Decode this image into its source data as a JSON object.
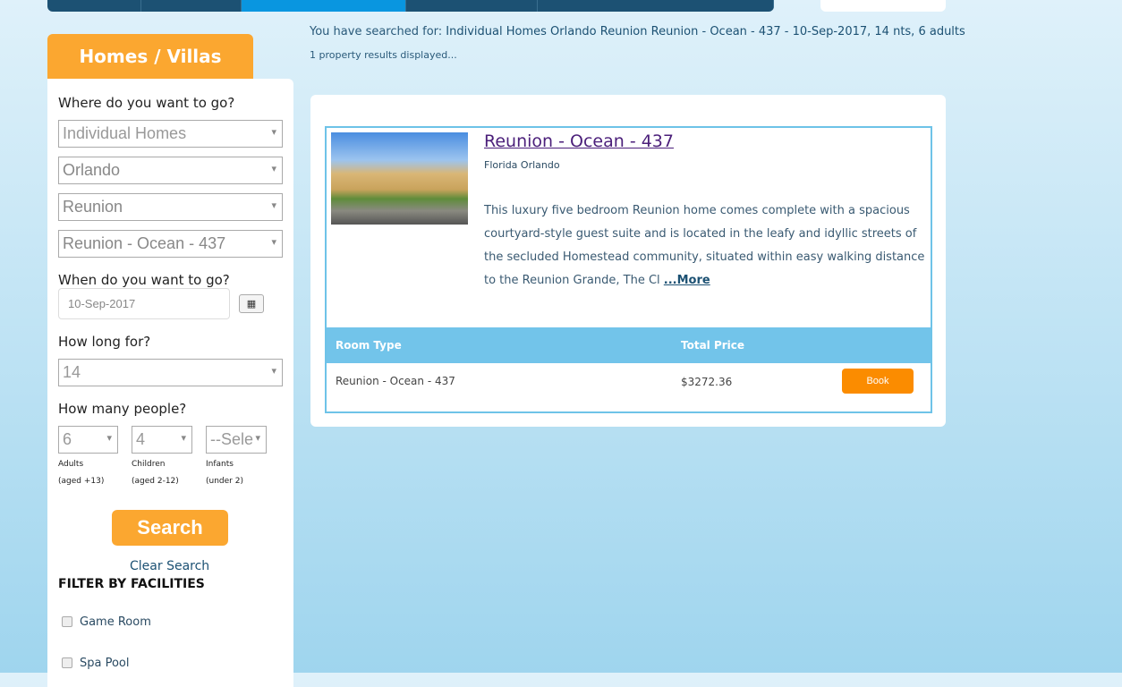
{
  "sidebar": {
    "tab": "Homes / Villas",
    "where_label": "Where do you want to go?",
    "selects": [
      "Individual Homes",
      "Orlando",
      "Reunion",
      "Reunion - Ocean - 437"
    ],
    "when_label": "When do you want to go?",
    "date": "10-Sep-2017",
    "howlong_label": "How long for?",
    "nights": "14",
    "people_label": "How many people?",
    "adults": "6",
    "children": "4",
    "infants": "--Sele",
    "adults_label": "Adults",
    "adults_sub": "(aged +13)",
    "children_label": "Children",
    "children_sub": "(aged 2-12)",
    "infants_label": "Infants",
    "infants_sub": "(under 2)",
    "search": "Search",
    "clear": "Clear Search",
    "filter_title": "FILTER BY FACILITIES",
    "facilities": [
      "Game Room",
      "Spa Pool"
    ]
  },
  "results": {
    "searched_prefix": "You have searched for: ",
    "searched": "Individual Homes Orlando Reunion Reunion - Ocean - 437 - 10-Sep-2017, 14 nts, 6 adults",
    "count": "1 property results displayed...",
    "title": "Reunion - Ocean - 437",
    "location": "Florida Orlando",
    "description": "This luxury five bedroom Reunion home comes complete with a spacious courtyard-style guest suite and is located in the leafy and idyllic streets of the secluded Homestead community, situated within easy walking distance to the Reunion Grande, The Cl",
    "more": "...More",
    "col_room": "Room Type",
    "col_price": "Total Price",
    "room": "Reunion - Ocean - 437",
    "price": "$3272.36",
    "book": "Book"
  }
}
